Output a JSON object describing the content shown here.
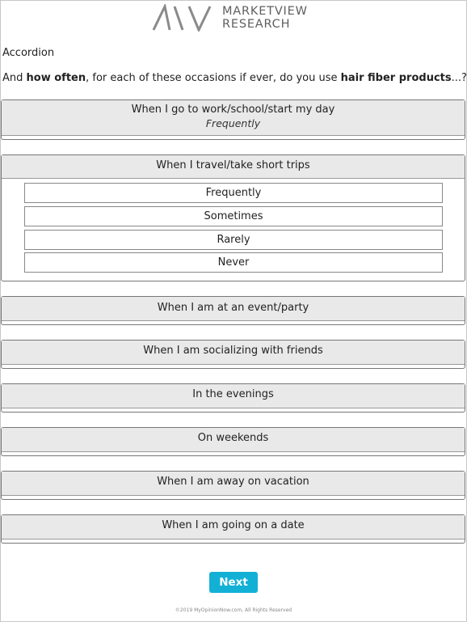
{
  "brand": {
    "line1": "MARKETVIEW",
    "line2": "RESEARCH",
    "accent_color": "#888888",
    "logo_icon": "mv-logo-mark"
  },
  "question": {
    "type_label": "Accordion",
    "text_pre": "And ",
    "text_bold1": "how often",
    "text_mid": ", for each of these occasions if ever, do you use ",
    "text_bold2": "hair fiber products",
    "text_post": "...?"
  },
  "occasions": [
    {
      "label": "When I go to work/school/start my day",
      "answer": "Frequently"
    },
    {
      "label": "When I travel/take short trips",
      "options": [
        "Frequently",
        "Sometimes",
        "Rarely",
        "Never"
      ]
    },
    {
      "label": "When I am at an event/party"
    },
    {
      "label": "When I am socializing with friends"
    },
    {
      "label": "In the evenings"
    },
    {
      "label": "On weekends"
    },
    {
      "label": "When I am away on vacation"
    },
    {
      "label": "When I am going on a date"
    }
  ],
  "next_button": {
    "label": "Next",
    "color": "#13b0d6"
  },
  "footer": "©2019 MyOpinionNow.com, All Rights Reserved"
}
